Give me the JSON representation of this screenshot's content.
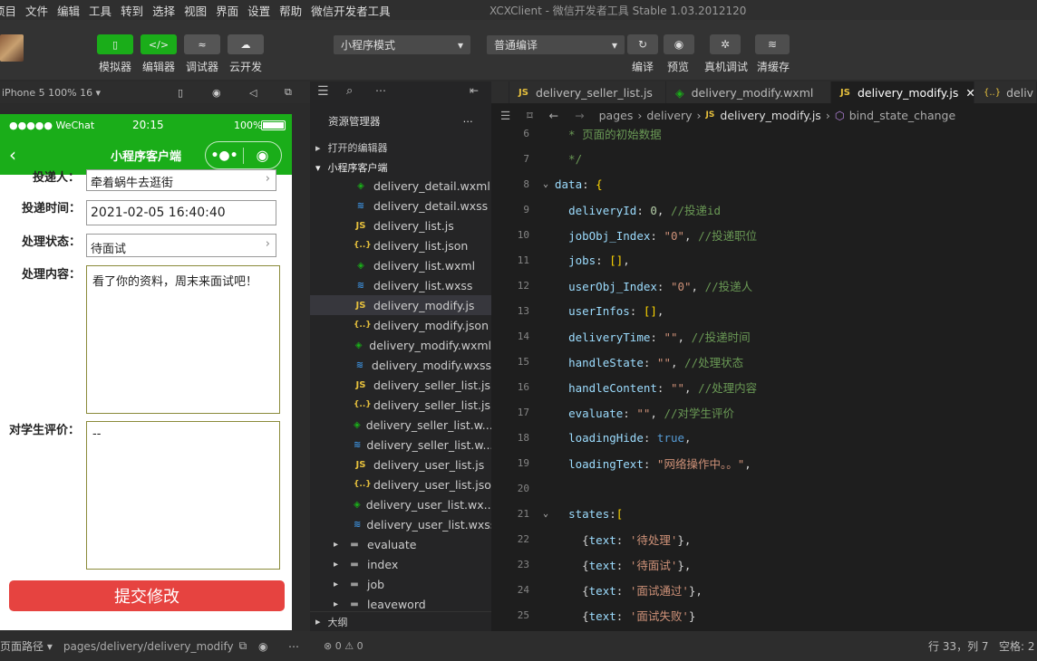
{
  "menu": [
    "项目",
    "文件",
    "编辑",
    "工具",
    "转到",
    "选择",
    "视图",
    "界面",
    "设置",
    "帮助",
    "微信开发者工具"
  ],
  "window_title": "XCXClient - 微信开发者工具 Stable 1.03.2012120",
  "toolbar": {
    "buttons": [
      {
        "label": "模拟器",
        "icon": "▯"
      },
      {
        "label": "编辑器",
        "icon": "</>"
      },
      {
        "label": "调试器",
        "icon": "≈"
      },
      {
        "label": "云开发",
        "icon": "☁"
      }
    ],
    "mode_select": "小程序模式",
    "compile_select": "普通编译",
    "right_buttons": [
      {
        "label": "编译",
        "icon": "↻"
      },
      {
        "label": "预览",
        "icon": "◉"
      },
      {
        "label": "真机调试",
        "icon": "✲"
      },
      {
        "label": "清缓存",
        "icon": "≋"
      }
    ]
  },
  "simulator": {
    "device": "iPhone 5 100% 16 ▾",
    "status": {
      "carrier": "●●●●● WeChat",
      "time": "20:15",
      "battery": "100%"
    },
    "nav_title": "小程序客户端",
    "form": {
      "person_label": "投递人：",
      "person_value": "牵着蜗牛去逛街",
      "time_label": "投递时间：",
      "time_value": "2021-02-05 16:40:40",
      "state_label": "处理状态：",
      "state_value": "待面试",
      "content_label": "处理内容：",
      "content_value": "看了你的资料，周末来面试吧！",
      "evaluate_label": "对学生评价：",
      "evaluate_value": "--"
    },
    "submit_label": "提交修改",
    "footer": {
      "path_label": "页面路径 ▾",
      "path": "pages/delivery/delivery_modify"
    }
  },
  "explorer": {
    "title": "资源管理器",
    "open_editors": "打开的编辑器",
    "project": "小程序客户端",
    "files": [
      {
        "name": "delivery_detail.wxml",
        "type": "wxml"
      },
      {
        "name": "delivery_detail.wxss",
        "type": "wxss"
      },
      {
        "name": "delivery_list.js",
        "type": "js"
      },
      {
        "name": "delivery_list.json",
        "type": "json"
      },
      {
        "name": "delivery_list.wxml",
        "type": "wxml"
      },
      {
        "name": "delivery_list.wxss",
        "type": "wxss"
      },
      {
        "name": "delivery_modify.js",
        "type": "js"
      },
      {
        "name": "delivery_modify.json",
        "type": "json"
      },
      {
        "name": "delivery_modify.wxml",
        "type": "wxml"
      },
      {
        "name": "delivery_modify.wxss",
        "type": "wxss"
      },
      {
        "name": "delivery_seller_list.js",
        "type": "js"
      },
      {
        "name": "delivery_seller_list.js...",
        "type": "json"
      },
      {
        "name": "delivery_seller_list.w...",
        "type": "wxml"
      },
      {
        "name": "delivery_seller_list.w...",
        "type": "wxss"
      },
      {
        "name": "delivery_user_list.js",
        "type": "js"
      },
      {
        "name": "delivery_user_list.json",
        "type": "json"
      },
      {
        "name": "delivery_user_list.wx...",
        "type": "wxml"
      },
      {
        "name": "delivery_user_list.wxss",
        "type": "wxss"
      }
    ],
    "folders": [
      "evaluate",
      "index",
      "job",
      "leaveword"
    ],
    "outline": "大纲",
    "problems": "⊗ 0 ⚠ 0"
  },
  "editor": {
    "tabs": [
      "delivery_seller_list.js",
      "delivery_modify.wxml",
      "delivery_modify.js",
      "deliv"
    ],
    "breadcrumb": [
      "pages",
      "delivery",
      "delivery_modify.js",
      "bind_state_change"
    ],
    "lines": [
      {
        "n": "6",
        "t": "  * 页面的初始数据"
      },
      {
        "n": "7",
        "t": "  */"
      },
      {
        "n": "8",
        "t": "data: {"
      },
      {
        "n": "9",
        "t": "  deliveryId: 0, //投递id"
      },
      {
        "n": "10",
        "t": "  jobObj_Index: \"0\", //投递职位"
      },
      {
        "n": "11",
        "t": "  jobs: [],"
      },
      {
        "n": "12",
        "t": "  userObj_Index: \"0\", //投递人"
      },
      {
        "n": "13",
        "t": "  userInfos: [],"
      },
      {
        "n": "14",
        "t": "  deliveryTime: \"\", //投递时间"
      },
      {
        "n": "15",
        "t": "  handleState: \"\", //处理状态"
      },
      {
        "n": "16",
        "t": "  handleContent: \"\", //处理内容"
      },
      {
        "n": "17",
        "t": "  evaluate: \"\", //对学生评价"
      },
      {
        "n": "18",
        "t": "  loadingHide: true,"
      },
      {
        "n": "19",
        "t": "  loadingText: \"网络操作中。。\","
      },
      {
        "n": "20",
        "t": ""
      },
      {
        "n": "21",
        "t": "  states:["
      },
      {
        "n": "22",
        "t": "    {text: '待处理'},"
      },
      {
        "n": "23",
        "t": "    {text: '待面试'},"
      },
      {
        "n": "24",
        "t": "    {text: '面试通过'},"
      },
      {
        "n": "25",
        "t": "    {text: '面试失败'}"
      }
    ],
    "status_pos": "行 33，列 7",
    "status_indent": "空格: 2"
  }
}
